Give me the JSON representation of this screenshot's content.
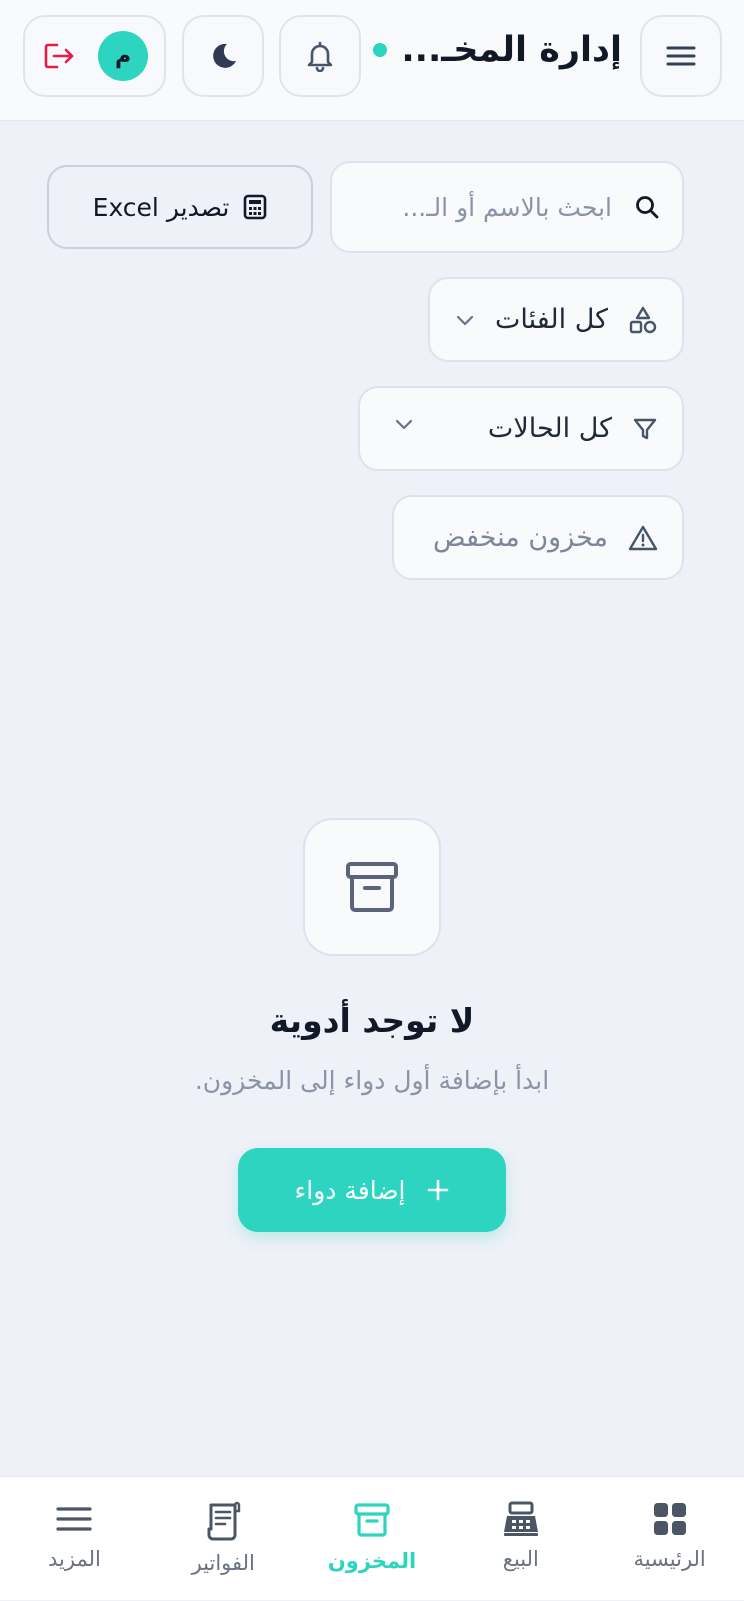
{
  "header": {
    "title": "إدارة المخـ...",
    "user_initial": "م",
    "colors": {
      "status_dot": "#2dd4bf",
      "logout": "#e11d48"
    }
  },
  "toolbar": {
    "search_placeholder": "ابحث بالاسم أو الـ...",
    "export_label": "تصدير Excel"
  },
  "filters": {
    "category_label": "كل الفئات",
    "status_label": "كل الحالات",
    "low_stock_label": "مخزون منخفض"
  },
  "empty_state": {
    "title": "لا توجد أدوية",
    "subtitle": "ابدأ بإضافة أول دواء إلى المخزون.",
    "button_label": "إضافة دواء"
  },
  "bottom_nav": {
    "home": "الرئيسية",
    "sales": "البيع",
    "inventory": "المخزون",
    "invoices": "الفواتير",
    "more": "المزيد",
    "active": "inventory",
    "accent": "#2dd4bf"
  }
}
